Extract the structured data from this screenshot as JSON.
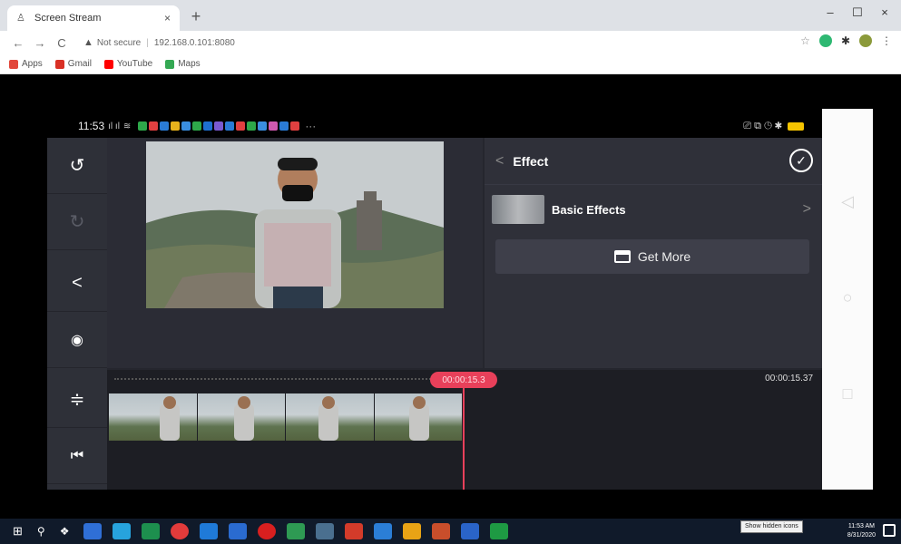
{
  "browser": {
    "tab_title": "Screen Stream",
    "tab_close": "×",
    "new_tab": "+",
    "window_controls": [
      "–",
      "☐",
      "×"
    ],
    "address_security": "Not secure",
    "address_url": "192.168.0.101:8080"
  },
  "bookmarks": [
    {
      "label": "Apps",
      "color": "#e2473b"
    },
    {
      "label": "Gmail",
      "color": "#d93025"
    },
    {
      "label": "YouTube",
      "color": "#ff0000"
    },
    {
      "label": "Maps",
      "color": "#34a853"
    }
  ],
  "phone_status": {
    "time": "11:53",
    "signal": "ıl ıl",
    "right_icons": "⎚ ⧉ ◷ ✱"
  },
  "left_rail": {
    "undo_icon": "↺",
    "redo_icon": "↻",
    "share_icon": "<",
    "settings_icon": "◉",
    "split_icon": "≑",
    "jump_start_icon": "⏮"
  },
  "effect_panel": {
    "title": "Effect",
    "back": "<",
    "confirm": "✓",
    "item_label": "Basic Effects",
    "item_chevron": ">",
    "get_more_label": "Get More"
  },
  "timeline": {
    "playhead_time": "00:00:15.3",
    "total_time": "00:00:15.37"
  },
  "android_nav": {
    "back": "◁",
    "home": "○",
    "recents": "□"
  },
  "taskbar": {
    "tooltip": "Show hidden icons",
    "clock_time": "11:53 AM",
    "clock_date": "8/31/2020",
    "icons": [
      "#2f6fd6",
      "#27a3dd",
      "#3b77d1",
      "#1d8f4e",
      "#e23b3b",
      "#1f7ad8",
      "#2a6bd0",
      "#d81f1f",
      "#2e9a53",
      "#1c7ad0",
      "#d33b2a",
      "#2b7ed6",
      "#e8a315",
      "#c94e2b",
      "#2a64c8",
      "#1e9a43"
    ]
  }
}
